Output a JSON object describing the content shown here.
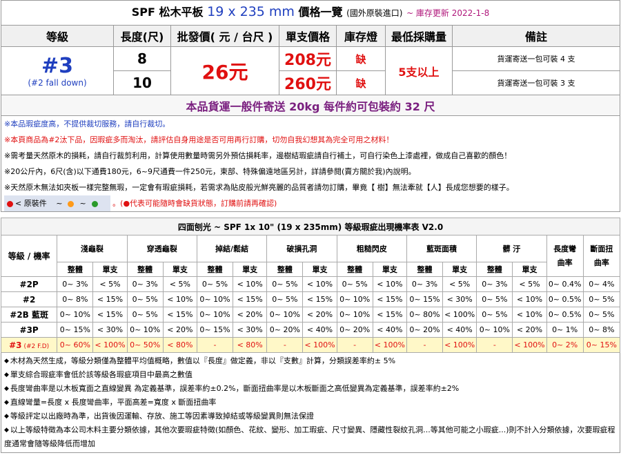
{
  "title": {
    "main": "SPF 松木平板",
    "dim": "19 x 235 mm",
    "price_list": "價格一覽",
    "origin": "(國外原裝進口)",
    "updated": "~ 庫存更新 2022-1-8"
  },
  "price_table": {
    "headers": [
      "等級",
      "長度(尺)",
      "批發價( 元 / 台尺 )",
      "單支價格",
      "庫存燈",
      "最低採購量",
      "備註"
    ],
    "grade": "#3",
    "grade_sub": "(#2 fall down)",
    "wholesale": "26元",
    "min_order": "5支以上",
    "rows": [
      {
        "length": "8",
        "unit_price": "208元",
        "stock": "缺",
        "remark": "貨運寄送一包可裝 4 支"
      },
      {
        "length": "10",
        "unit_price": "260元",
        "stock": "缺",
        "remark": "貨運寄送一包可裝 3 支"
      }
    ],
    "shipping": "本品貨運一般件寄送 20kg 每件約可包裝約 32 尺"
  },
  "notes": [
    {
      "text": "※本品瑕疵度高，不提供裁切服務，請自行裁切。",
      "color": "blue"
    },
    {
      "text": "※本頁商品為#2汰下品，因瑕疵多而淘汰，請評估自身用途是否可用再行訂購，切勿自我幻想其為完全可用之材料！",
      "color": "red"
    },
    {
      "text": "※需考量天然原木的損耗，請自行裁剪利用，計算使用數量時需另外預估損耗率，邊樹結瑕疵請自行補土，可自行染色上漆處裡，做成自己喜歡的顏色！",
      "color": "black"
    },
    {
      "text": "※20公斤內，6尺(含)以下通費180元，6~9尺通費一件250元，東部、特殊偏遠地區另計，詳請參閱(賣方關於我)內說明。",
      "color": "black"
    },
    {
      "text": "※天然原木無法如夾板一樣完整無瑕，一定會有瑕疵損耗，若需求為貼皮般光鮮亮麗的品質者請勿訂購，畢竟【 樹】無法牽就【人】長成您想要的樣子。",
      "color": "black"
    }
  ],
  "legend": {
    "label": "< 原裝件",
    "sep": "~",
    "warning": "。(●代表可能隨時會缺貨狀態，訂購前請再確認)",
    "colors": [
      "#e01010",
      "#ff9a1a",
      "#2a9a2a"
    ]
  },
  "defect_table": {
    "caption": "四面刨光 ~ SPF 1x 10\"  (19 x 235mm) 等級瑕疵出現機率表 V2.0",
    "row_header": "等級 / 機率",
    "columns": [
      "淺龜裂",
      "穿透龜裂",
      "掉結/鬆結",
      "破損孔洞",
      "粗糙閃皮",
      "藍斑面積",
      "髒 汙"
    ],
    "columns_single": [
      "長度彎曲率",
      "斷面扭曲率"
    ],
    "sub_headers": [
      "整體",
      "單支"
    ],
    "rows": [
      {
        "grade": "#2P",
        "cells": [
          "0~ 3%",
          "< 5%",
          "0~ 3%",
          "< 5%",
          "0~ 5%",
          "< 10%",
          "0~ 5%",
          "< 10%",
          "0~ 5%",
          "< 10%",
          "0~ 3%",
          "< 5%",
          "0~ 3%",
          "< 5%",
          "0~ 0.4%",
          "0~ 4%"
        ]
      },
      {
        "grade": "#2",
        "cells": [
          "0~ 8%",
          "< 15%",
          "0~ 5%",
          "< 10%",
          "0~ 10%",
          "< 15%",
          "0~ 5%",
          "< 15%",
          "0~ 10%",
          "< 15%",
          "0~ 15%",
          "< 30%",
          "0~ 5%",
          "< 10%",
          "0~ 0.5%",
          "0~ 5%"
        ]
      },
      {
        "grade": "#2B 藍斑",
        "cells": [
          "0~ 10%",
          "< 15%",
          "0~ 5%",
          "< 15%",
          "0~ 10%",
          "< 20%",
          "0~ 10%",
          "< 20%",
          "0~ 10%",
          "< 15%",
          "0~ 80%",
          "< 100%",
          "0~ 5%",
          "< 10%",
          "0~ 0.5%",
          "0~ 5%"
        ]
      },
      {
        "grade": "#3P",
        "cells": [
          "0~ 15%",
          "< 30%",
          "0~ 10%",
          "< 20%",
          "0~ 15%",
          "< 30%",
          "0~ 20%",
          "< 40%",
          "0~ 20%",
          "< 40%",
          "0~ 20%",
          "< 40%",
          "0~ 10%",
          "< 20%",
          "0~ 1%",
          "0~ 8%"
        ]
      },
      {
        "grade": "#3",
        "grade_sub": "(#2 F.D)",
        "highlight": true,
        "cells": [
          "0~ 60%",
          "< 100%",
          "0~ 50%",
          "< 80%",
          "-",
          "< 80%",
          "-",
          "< 100%",
          "-",
          "< 100%",
          "-",
          "< 100%",
          "-",
          "< 100%",
          "0~ 2%",
          "0~ 15%"
        ]
      }
    ]
  },
  "footnotes": [
    "木材為天然生成，等級分類僅為整體平均值概略，數值以『長度』做定義，非以『支數』計算，分類誤差率約± 5%",
    "單支綜合瑕疵率會低於該等級各瑕疵項目中最高之數值",
    "長度彎曲率是以木板寬面之直線變異 為定義基準，誤差率約±0.2%，斷面扭曲率是以木板斷面之高低變異為定義基準，誤差率約±2%",
    "直線彎量=長度 x 長度彎曲率，平面高差=寬度 x 斷面扭曲率",
    "等級評定以出廠時為準，出貨後因運輸、存放、施工等因素導致掉結或等級變異則無法保證",
    "以上等級特徵為本公司木料主要分類依據，其他次要瑕疵特徵(如顏色、花紋、變形、加工瑕疵、尺寸變異、隱藏性裂紋孔洞...等其他可能之小瑕疵...)則不計入分類依據，次要瑕疵程度通常會隨等級降低而增加"
  ]
}
